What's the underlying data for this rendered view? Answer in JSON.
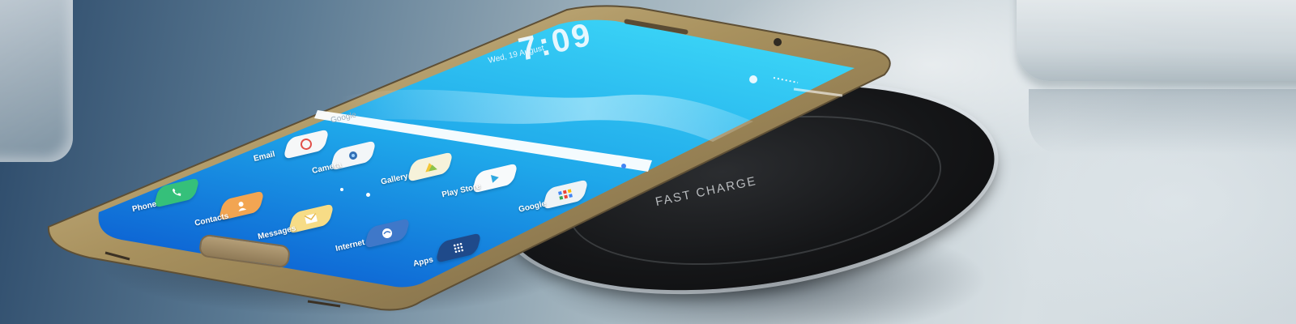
{
  "phone_screen": {
    "time": "7:09",
    "date": "Wed, 19 August",
    "search_placeholder": "Google"
  },
  "charger": {
    "label": "FAST CHARGE"
  },
  "apps": [
    {
      "label": "Email",
      "icon": "email-icon",
      "color": "#f6f7f8"
    },
    {
      "label": "Camera",
      "icon": "camera-icon",
      "color": "#f3f6f8"
    },
    {
      "label": "Gallery",
      "icon": "gallery-icon",
      "color": "#f6f2da"
    },
    {
      "label": "Play Store",
      "icon": "play-store-icon",
      "color": "#f8fafb"
    },
    {
      "label": "Google",
      "icon": "google-folder-icon",
      "color": "#eef3f6"
    },
    {
      "label": "Phone",
      "icon": "phone-icon",
      "color": "#35c07a"
    },
    {
      "label": "Contacts",
      "icon": "contacts-icon",
      "color": "#f2a552"
    },
    {
      "label": "Messages",
      "icon": "messages-icon",
      "color": "#f7dc86"
    },
    {
      "label": "Internet",
      "icon": "internet-icon",
      "color": "#3f78c9"
    },
    {
      "label": "Apps",
      "icon": "apps-grid-icon",
      "color": "#1f4a8a"
    }
  ],
  "colors": {
    "screen_top": "#1fc3ee",
    "screen_bottom": "#0c69d8",
    "phone_frame": "#a8915e"
  }
}
